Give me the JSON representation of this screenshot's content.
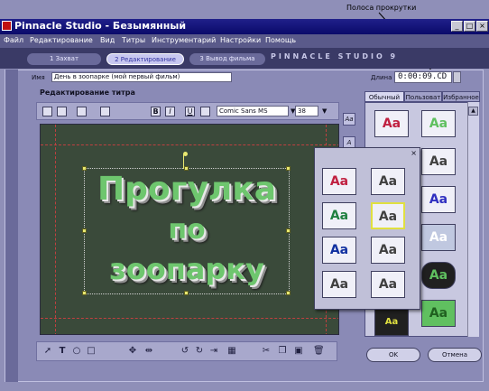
{
  "callout": {
    "label": "Полоса прокрутки"
  },
  "window": {
    "title": "Pinnacle Studio - Безымянный",
    "minimize": "_",
    "maximize": "□",
    "close": "×"
  },
  "menu": [
    "Файл",
    "Редактирование",
    "Вид",
    "Титры",
    "Инструментарий",
    "Настройки",
    "Помощь"
  ],
  "tabs": [
    {
      "label": "1 Захват"
    },
    {
      "label": "2 Редактирование"
    },
    {
      "label": "3 Вывод фильма"
    }
  ],
  "brand": "PINNACLE STUDIO 9",
  "title_editor": {
    "name_label": "Имя",
    "name_value": "День в зоопарке (мой первый фильм)",
    "duration_label": "Длина",
    "duration_value": "0:00:09.CD",
    "heading": "Редактирование титра",
    "font_name": "Comic Sans MS",
    "font_size": "38",
    "bold": "B",
    "italic": "I",
    "underline": "U"
  },
  "canvas_text": {
    "line1": "Прогулка",
    "line2": "по",
    "line3": "зоопарку"
  },
  "style_tabs": [
    "Обычный",
    "Пользоват",
    "Избранное"
  ],
  "gallery_thumbs": [
    "Aa",
    "Aa",
    "Aa",
    "Aa",
    "Aa",
    "Aa",
    "Aa",
    "Aa",
    "Aa",
    "Aa",
    "Aa",
    "Aa"
  ],
  "popup_thumbs": [
    "Aa",
    "Aa",
    "Aa",
    "Aa",
    "Aa",
    "Aa",
    "Aa",
    "Aa"
  ],
  "popup_close": "×",
  "side_buttons": [
    "Aa",
    "A"
  ],
  "buttons": {
    "ok": "OK",
    "cancel": "Отмена"
  }
}
